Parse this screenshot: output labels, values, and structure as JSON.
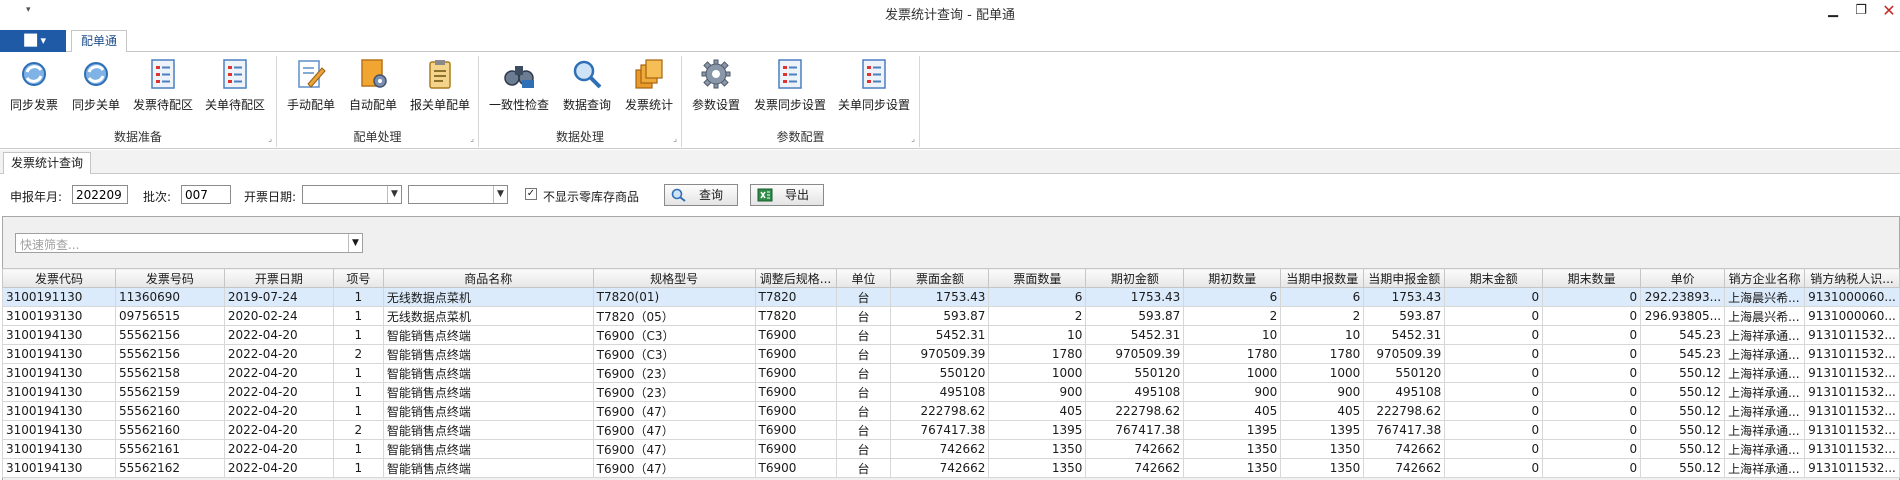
{
  "window": {
    "title": "发票统计查询 - 配单通",
    "qat_arrow": "▾",
    "minimize": "▁",
    "restore": "❐",
    "close": "✕"
  },
  "ribbon": {
    "app_button": "▐█ ▾",
    "tab": "配单通",
    "groups": [
      {
        "label": "数据准备",
        "buttons": [
          {
            "label": "同步发票",
            "icon": "sync-icon"
          },
          {
            "label": "同步关单",
            "icon": "sync-icon"
          },
          {
            "label": "发票待配区",
            "icon": "list-icon"
          },
          {
            "label": "关单待配区",
            "icon": "list-icon"
          }
        ]
      },
      {
        "label": "配单处理",
        "buttons": [
          {
            "label": "手动配单",
            "icon": "edit-doc-icon"
          },
          {
            "label": "自动配单",
            "icon": "auto-config-icon"
          },
          {
            "label": "报关单配单",
            "icon": "clipboard-icon"
          }
        ]
      },
      {
        "label": "数据处理",
        "buttons": [
          {
            "label": "一致性检查",
            "icon": "binoculars-icon"
          },
          {
            "label": "数据查询",
            "icon": "magnifier-icon"
          },
          {
            "label": "发票统计",
            "icon": "stack-icon"
          }
        ]
      },
      {
        "label": "参数配置",
        "buttons": [
          {
            "label": "参数设置",
            "icon": "gear-icon"
          },
          {
            "label": "发票同步设置",
            "icon": "list-icon"
          },
          {
            "label": "关单同步设置",
            "icon": "list-icon"
          }
        ]
      }
    ],
    "launcher": "⌟"
  },
  "doc_tab": "发票统计查询",
  "filters": {
    "period_label": "申报年月:",
    "period_value": "202209",
    "batch_label": "批次:",
    "batch_value": "007",
    "date_label": "开票日期:",
    "date_from": "",
    "date_to": "",
    "hide_zero_label": "不显示零库存商品",
    "hide_zero_checked": "✓",
    "query_label": "查询",
    "export_label": "导出"
  },
  "quick_filter": {
    "placeholder": "快速筛查..."
  },
  "grid": {
    "columns": [
      "发票代码",
      "发票号码",
      "开票日期",
      "项号",
      "商品名称",
      "规格型号",
      "调整后规格...",
      "单位",
      "票面金额",
      "票面数量",
      "期初金额",
      "期初数量",
      "当期申报数量",
      "当期申报金额",
      "期末金额",
      "期末数量",
      "单价",
      "销方企业名称",
      "销方纳税人识..."
    ],
    "rows": [
      [
        "3100191130",
        "11360690",
        "2019-07-24",
        "1",
        "无线数据点菜机",
        "T7820(01)",
        "T7820",
        "台",
        "1753.43",
        "6",
        "1753.43",
        "6",
        "6",
        "1753.43",
        "0",
        "0",
        "292.23893...",
        "上海晨兴希...",
        "9131000060..."
      ],
      [
        "3100193130",
        "09756515",
        "2020-02-24",
        "1",
        "无线数据点菜机",
        "T7820（05）",
        "T7820",
        "台",
        "593.87",
        "2",
        "593.87",
        "2",
        "2",
        "593.87",
        "0",
        "0",
        "296.93805...",
        "上海晨兴希...",
        "9131000060..."
      ],
      [
        "3100194130",
        "55562156",
        "2022-04-20",
        "1",
        "智能销售点终端",
        "T6900（C3）",
        "T6900",
        "台",
        "5452.31",
        "10",
        "5452.31",
        "10",
        "10",
        "5452.31",
        "0",
        "0",
        "545.23",
        "上海祥承通...",
        "9131011532..."
      ],
      [
        "3100194130",
        "55562156",
        "2022-04-20",
        "2",
        "智能销售点终端",
        "T6900（C3）",
        "T6900",
        "台",
        "970509.39",
        "1780",
        "970509.39",
        "1780",
        "1780",
        "970509.39",
        "0",
        "0",
        "545.23",
        "上海祥承通...",
        "9131011532..."
      ],
      [
        "3100194130",
        "55562158",
        "2022-04-20",
        "1",
        "智能销售点终端",
        "T6900（23）",
        "T6900",
        "台",
        "550120",
        "1000",
        "550120",
        "1000",
        "1000",
        "550120",
        "0",
        "0",
        "550.12",
        "上海祥承通...",
        "9131011532..."
      ],
      [
        "3100194130",
        "55562159",
        "2022-04-20",
        "1",
        "智能销售点终端",
        "T6900（23）",
        "T6900",
        "台",
        "495108",
        "900",
        "495108",
        "900",
        "900",
        "495108",
        "0",
        "0",
        "550.12",
        "上海祥承通...",
        "9131011532..."
      ],
      [
        "3100194130",
        "55562160",
        "2022-04-20",
        "1",
        "智能销售点终端",
        "T6900（47）",
        "T6900",
        "台",
        "222798.62",
        "405",
        "222798.62",
        "405",
        "405",
        "222798.62",
        "0",
        "0",
        "550.12",
        "上海祥承通...",
        "9131011532..."
      ],
      [
        "3100194130",
        "55562160",
        "2022-04-20",
        "2",
        "智能销售点终端",
        "T6900（47）",
        "T6900",
        "台",
        "767417.38",
        "1395",
        "767417.38",
        "1395",
        "1395",
        "767417.38",
        "0",
        "0",
        "550.12",
        "上海祥承通...",
        "9131011532..."
      ],
      [
        "3100194130",
        "55562161",
        "2022-04-20",
        "1",
        "智能销售点终端",
        "T6900（47）",
        "T6900",
        "台",
        "742662",
        "1350",
        "742662",
        "1350",
        "1350",
        "742662",
        "0",
        "0",
        "550.12",
        "上海祥承通...",
        "9131011532..."
      ],
      [
        "3100194130",
        "55562162",
        "2022-04-20",
        "1",
        "智能销售点终端",
        "T6900（47）",
        "T6900",
        "台",
        "742662",
        "1350",
        "742662",
        "1350",
        "1350",
        "742662",
        "0",
        "0",
        "550.12",
        "上海祥承通...",
        "9131011532..."
      ]
    ]
  }
}
